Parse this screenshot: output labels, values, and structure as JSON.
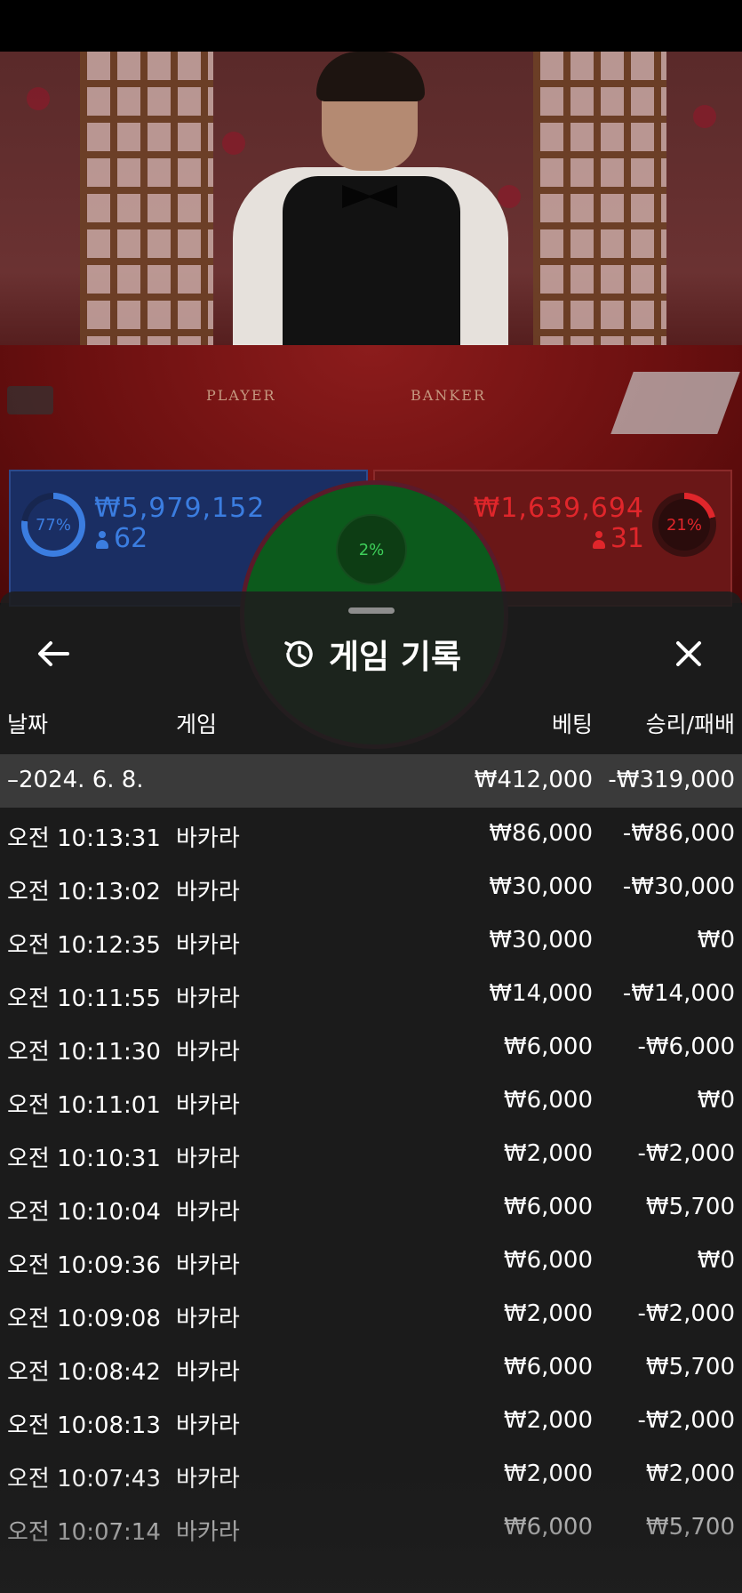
{
  "colors": {
    "player_blue": "#3b7de0",
    "banker_red": "#e0262b",
    "tie_green": "#3ed05a",
    "sheet_bg": "#1e1e1e",
    "summary_row_bg": "#3a3a3a"
  },
  "scene": {
    "player_label": "PLAYER",
    "banker_label": "BANKER"
  },
  "bet_stats": {
    "player": {
      "percent": "77%",
      "percent_value": 77,
      "amount": "₩5,979,152",
      "count": "62"
    },
    "banker": {
      "percent": "21%",
      "percent_value": 21,
      "amount": "₩1,639,694",
      "count": "31"
    },
    "tie": {
      "percent": "2%",
      "percent_value": 2
    }
  },
  "history": {
    "title": "게임 기록",
    "icons": {
      "back": "arrow-left-icon",
      "history": "history-clock-icon",
      "close": "close-icon"
    },
    "columns": {
      "date": "날짜",
      "game": "게임",
      "bet": "베팅",
      "result": "승리/패배"
    },
    "summary": {
      "date": "–2024. 6. 8.",
      "bet": "₩412,000",
      "result": "-₩319,000"
    },
    "rows": [
      {
        "time": "오전 10:13:31",
        "game": "바카라",
        "bet": "₩86,000",
        "result": "-₩86,000"
      },
      {
        "time": "오전 10:13:02",
        "game": "바카라",
        "bet": "₩30,000",
        "result": "-₩30,000"
      },
      {
        "time": "오전 10:12:35",
        "game": "바카라",
        "bet": "₩30,000",
        "result": "₩0"
      },
      {
        "time": "오전 10:11:55",
        "game": "바카라",
        "bet": "₩14,000",
        "result": "-₩14,000"
      },
      {
        "time": "오전 10:11:30",
        "game": "바카라",
        "bet": "₩6,000",
        "result": "-₩6,000"
      },
      {
        "time": "오전 10:11:01",
        "game": "바카라",
        "bet": "₩6,000",
        "result": "₩0"
      },
      {
        "time": "오전 10:10:31",
        "game": "바카라",
        "bet": "₩2,000",
        "result": "-₩2,000"
      },
      {
        "time": "오전 10:10:04",
        "game": "바카라",
        "bet": "₩6,000",
        "result": "₩5,700"
      },
      {
        "time": "오전 10:09:36",
        "game": "바카라",
        "bet": "₩6,000",
        "result": "₩0"
      },
      {
        "time": "오전 10:09:08",
        "game": "바카라",
        "bet": "₩2,000",
        "result": "-₩2,000"
      },
      {
        "time": "오전 10:08:42",
        "game": "바카라",
        "bet": "₩6,000",
        "result": "₩5,700"
      },
      {
        "time": "오전 10:08:13",
        "game": "바카라",
        "bet": "₩2,000",
        "result": "-₩2,000"
      },
      {
        "time": "오전 10:07:43",
        "game": "바카라",
        "bet": "₩2,000",
        "result": "₩2,000"
      },
      {
        "time": "오전 10:07:14",
        "game": "바카라",
        "bet": "₩6,000",
        "result": "₩5,700"
      }
    ]
  }
}
